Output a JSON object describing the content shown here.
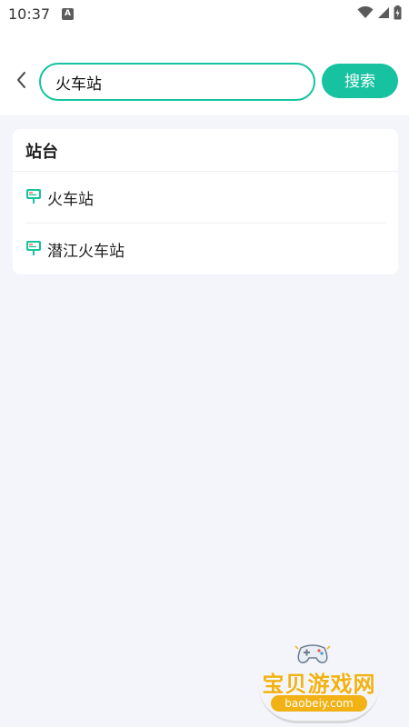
{
  "status_bar": {
    "time": "10:37",
    "notification_icon": "A"
  },
  "search": {
    "query": "火车站",
    "button_label": "搜索"
  },
  "results": {
    "section_title": "站台",
    "items": [
      {
        "label": "火车站",
        "icon": "bus-stop-sign-icon"
      },
      {
        "label": "潜江火车站",
        "icon": "bus-stop-sign-icon"
      }
    ]
  },
  "watermark": {
    "text": "宝贝游戏网",
    "url": "baobeiy.com"
  },
  "colors": {
    "accent": "#16c2a0",
    "background": "#f3f5fa",
    "watermark": "#f2b114"
  }
}
